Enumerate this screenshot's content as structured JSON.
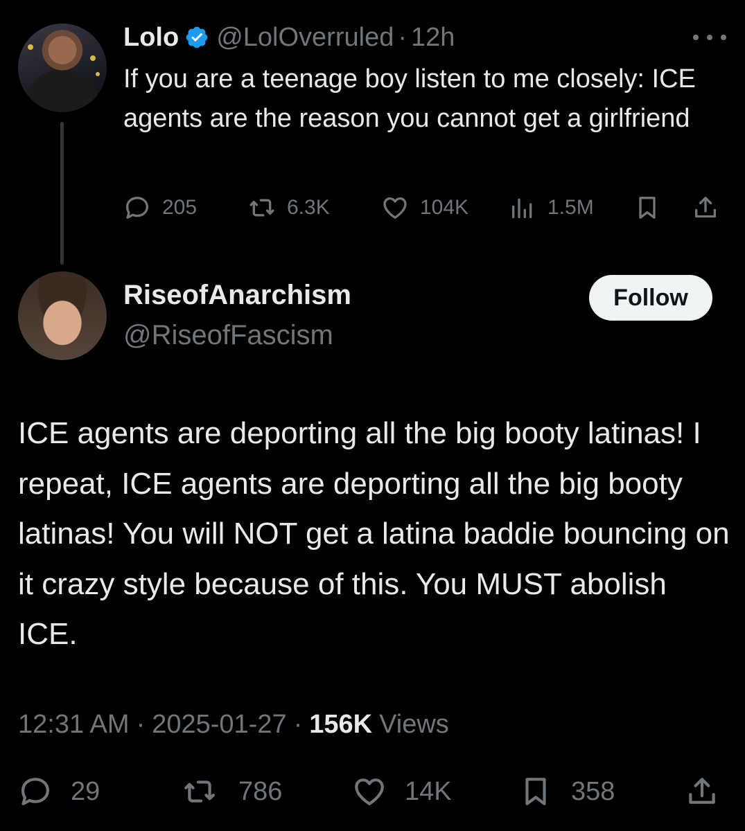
{
  "parent_tweet": {
    "author_name": "Lolo",
    "handle": "@LolOverruled",
    "separator": "·",
    "time": "12h",
    "text": "If you are a teenage boy listen to me closely: ICE agents are the reason you cannot get a girlfriend",
    "replies": "205",
    "reposts": "6.3K",
    "likes": "104K",
    "views": "1.5M",
    "icons": {
      "verified": "verified-badge-icon",
      "more": "more-icon",
      "reply": "reply-icon",
      "repost": "repost-icon",
      "like": "heart-icon",
      "views": "views-icon",
      "bookmark": "bookmark-icon",
      "share": "share-icon"
    }
  },
  "main_tweet": {
    "author_name": "RiseofAnarchism",
    "handle": "@RiseofFascism",
    "follow_label": "Follow",
    "text": "ICE agents are deporting all the big booty latinas! I repeat, ICE agents are deporting all the big booty latinas! You will NOT get a latina baddie bouncing on it crazy style because of this. You MUST abolish ICE.",
    "time": "12:31 AM",
    "date": "2025-01-27",
    "separator": "·",
    "views_count": "156K",
    "views_label": "Views",
    "replies": "29",
    "reposts": "786",
    "likes": "14K",
    "bookmarks": "358"
  },
  "colors": {
    "background": "#000000",
    "primary_text": "#e7e9ea",
    "secondary_text": "#71767b",
    "verified_blue": "#1d9bf0",
    "follow_button_bg": "#eff3f4",
    "follow_button_text": "#0f1419"
  }
}
